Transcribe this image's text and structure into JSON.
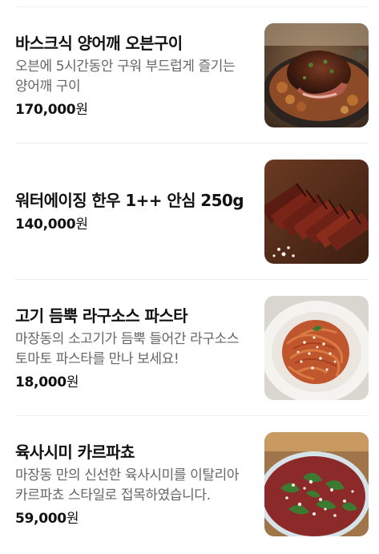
{
  "menu": {
    "currency_suffix": "원",
    "items": [
      {
        "name": "바스크식 양어깨 오븐구이",
        "description": "오븐에 5시간동안 구워 부드럽게 즐기는 양어깨 구이",
        "price": "170,000",
        "photo_icon": "roast-lamb-shoulder-photo"
      },
      {
        "name": "워터에이징 한우 1++ 안심 250g",
        "description": "",
        "price": "140,000",
        "photo_icon": "sliced-beef-tenderloin-photo"
      },
      {
        "name": "고기 듬뿍 라구소스 파스타",
        "description": "마장동의 소고기가 듬뿍 들어간 라구소스 토마토 파스타를 만나 보세요!",
        "price": "18,000",
        "photo_icon": "ragu-pasta-photo"
      },
      {
        "name": "육사시미 카르파쵸",
        "description": "마장동 만의 신선한 육사시미를 이탈리아 카르파쵸 스타일로 접목하였습니다.",
        "price": "59,000",
        "photo_icon": "beef-carpaccio-photo"
      }
    ]
  }
}
